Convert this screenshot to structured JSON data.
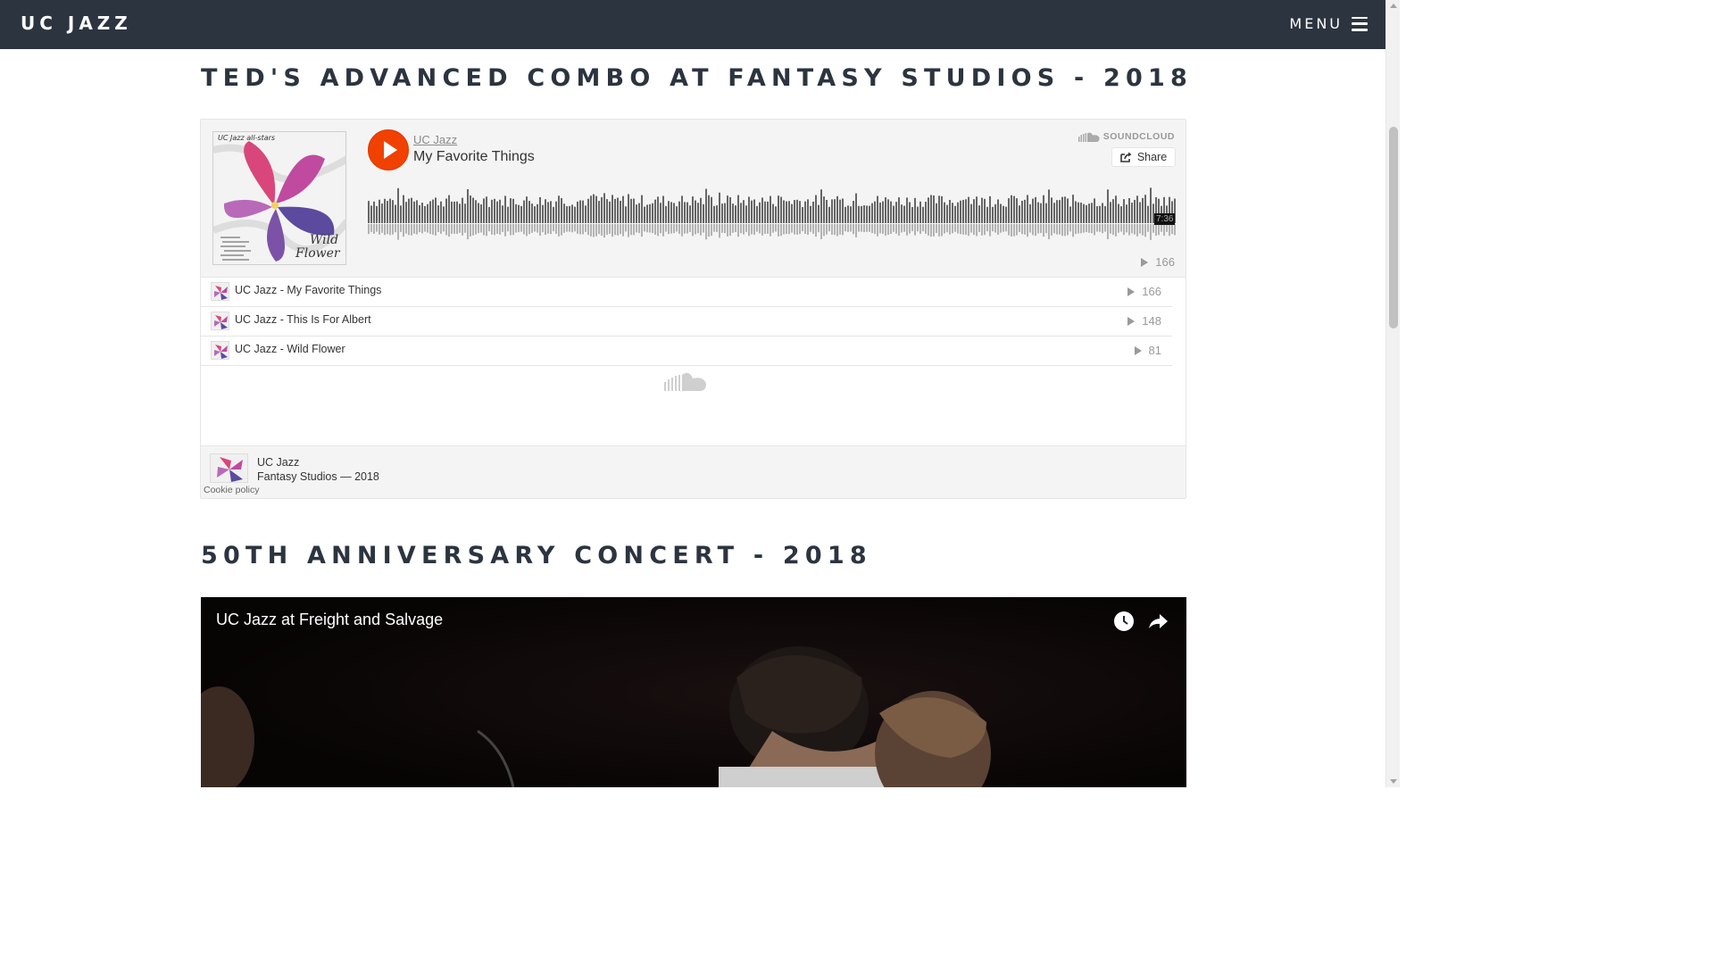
{
  "nav": {
    "brand": "UC JAZZ",
    "menu_label": "MENU"
  },
  "sections": [
    {
      "title": "TED'S ADVANCED COMBO AT FANTASY STUDIOS - 2018"
    },
    {
      "title": "50TH ANNIVERSARY CONCERT - 2018"
    }
  ],
  "soundcloud": {
    "user": "UC Jazz",
    "current_track": "My Favorite Things",
    "logo": "SOUNDCLOUD",
    "share_label": "Share",
    "duration": "7:36",
    "plays": "166",
    "tracks": [
      {
        "title": "UC Jazz - My Favorite Things",
        "plays": "166"
      },
      {
        "title": "UC Jazz - This Is For Albert",
        "plays": "148"
      },
      {
        "title": "UC Jazz - Wild Flower",
        "plays": "81"
      }
    ],
    "footer": {
      "user": "UC Jazz",
      "set_title": "Fantasy Studios — 2018",
      "cookie": "Cookie policy"
    },
    "artwork": {
      "top_text": "UC Jazz all-stars",
      "title_line1": "Wild",
      "title_line2": "Flower"
    },
    "colors": {
      "play": "#f04100",
      "waveform": "#666666"
    }
  },
  "video": {
    "title": "UC Jazz at Freight and Salvage"
  },
  "icons": [
    "hamburger-icon",
    "soundcloud-logo-icon",
    "share-icon",
    "play-icon",
    "clock-icon",
    "share-arrow-icon"
  ]
}
